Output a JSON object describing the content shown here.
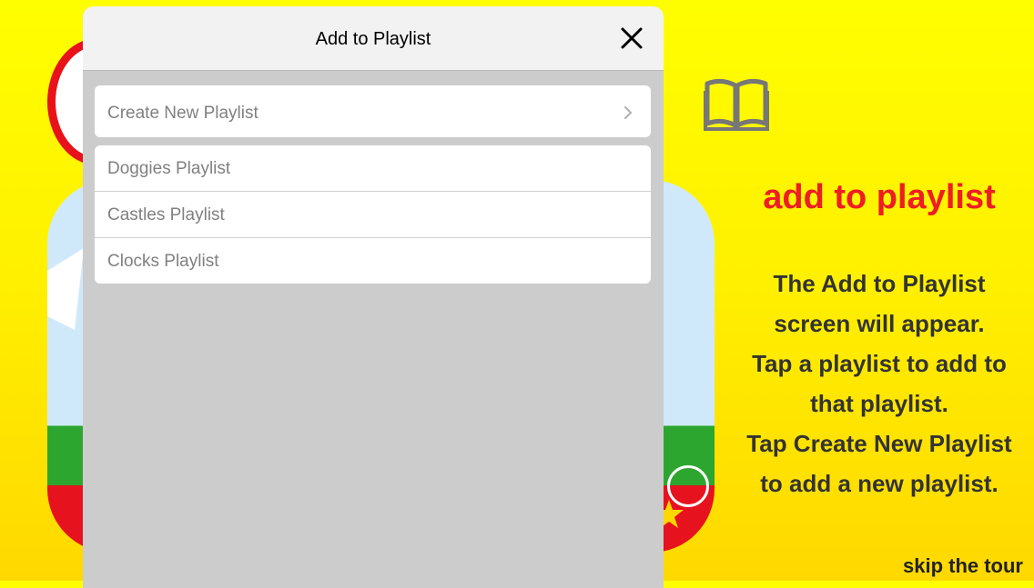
{
  "modal": {
    "title": "Add to Playlist",
    "create_label": "Create New Playlist",
    "playlists": [
      "Doggies Playlist",
      "Castles Playlist",
      "Clocks Playlist"
    ]
  },
  "tour": {
    "heading": "add to playlist",
    "lines": [
      "The Add to Playlist",
      "screen will appear.",
      "Tap a playlist to add to",
      "that playlist.",
      "Tap Create New Playlist",
      "to add a new playlist."
    ],
    "skip_label": "skip the tour"
  },
  "icons": {
    "close": "close-icon",
    "chevron": "chevron-right-icon",
    "book": "book-icon"
  },
  "colors": {
    "background": "#fff100",
    "heading": "#ee1d23",
    "modal_bg": "#cccccc",
    "header_bg": "#f2f2f2"
  }
}
